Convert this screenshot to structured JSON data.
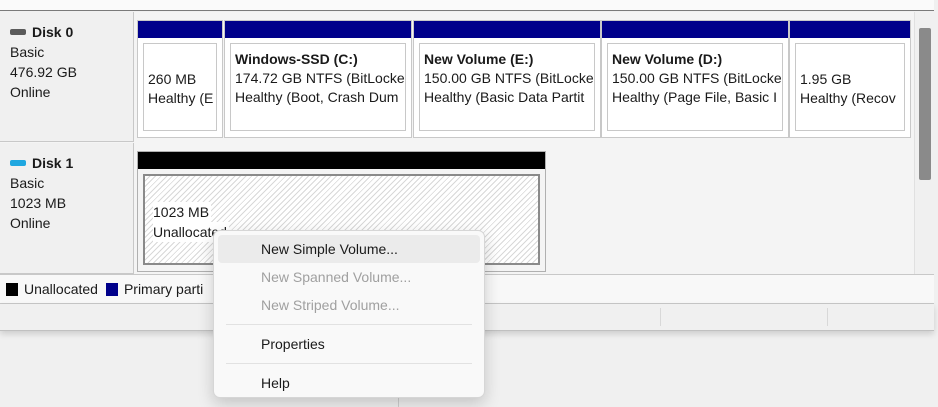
{
  "disks": [
    {
      "name": "Disk 0",
      "type": "Basic",
      "size": "476.92 GB",
      "status": "Online",
      "icon": "drive-icon",
      "volumes": [
        {
          "title": "",
          "size": "260 MB",
          "status": "Healthy (E"
        },
        {
          "title": "Windows-SSD  (C:)",
          "size": "174.72 GB NTFS (BitLocke",
          "status": "Healthy (Boot, Crash Dum"
        },
        {
          "title": "New Volume  (E:)",
          "size": "150.00 GB NTFS (BitLocke",
          "status": "Healthy (Basic Data Partit"
        },
        {
          "title": "New Volume  (D:)",
          "size": "150.00 GB NTFS (BitLocke",
          "status": "Healthy (Page File, Basic I"
        },
        {
          "title": "",
          "size": "1.95 GB",
          "status": "Healthy (Recov"
        }
      ]
    },
    {
      "name": "Disk 1",
      "type": "Basic",
      "size": "1023 MB",
      "status": "Online",
      "icon": "removable-drive-icon",
      "volumes": [
        {
          "size": "1023 MB",
          "status": "Unallocated"
        }
      ]
    }
  ],
  "legend": {
    "unallocated": "Unallocated",
    "primary": "Primary parti"
  },
  "colors": {
    "primary_partition": "#00008b",
    "unallocated": "#000000",
    "disk1_icon": "#1fa7e0",
    "disk0_icon": "#5a5a5a"
  },
  "context_menu": {
    "items": [
      {
        "label": "New Simple Volume...",
        "enabled": true
      },
      {
        "label": "New Spanned Volume...",
        "enabled": false
      },
      {
        "label": "New Striped Volume...",
        "enabled": false
      },
      {
        "label": "Properties",
        "enabled": true
      },
      {
        "label": "Help",
        "enabled": true
      }
    ]
  }
}
